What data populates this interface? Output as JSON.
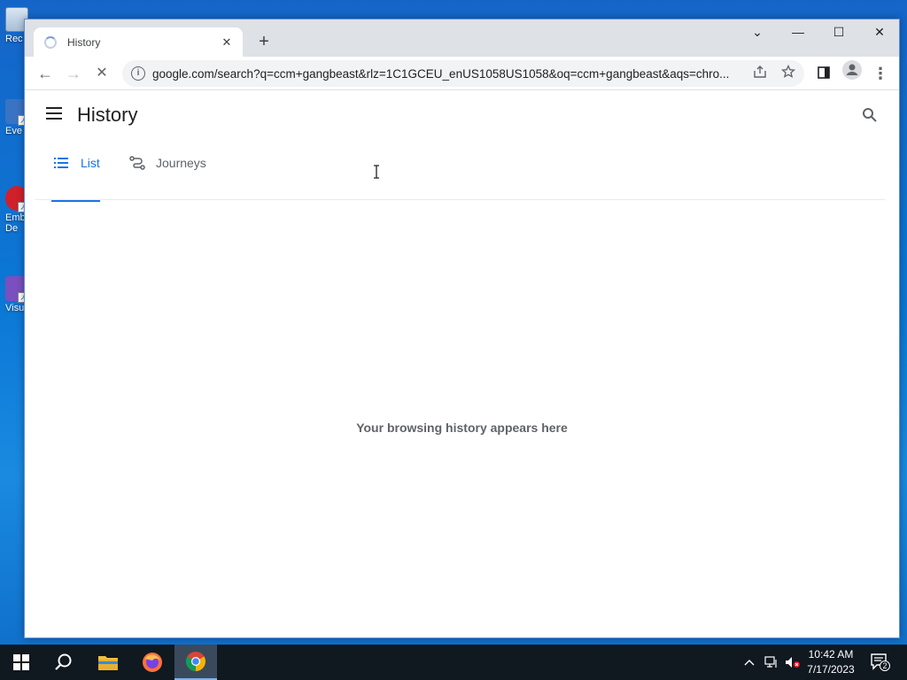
{
  "desktop": {
    "icons": [
      {
        "label": "Rec"
      },
      {
        "label": "Eve"
      },
      {
        "label": "Emb",
        "label2": "De"
      },
      {
        "label": "Visu"
      }
    ]
  },
  "browser": {
    "tab": {
      "title": "History",
      "close": "✕"
    },
    "new_tab": "+",
    "window_controls": {
      "tabsearch": "⌄",
      "minimize": "—",
      "maximize": "☐",
      "close": "✕"
    },
    "toolbar": {
      "back": "←",
      "forward": "→",
      "stop": "✕",
      "url": "google.com/search?q=ccm+gangbeast&rlz=1C1GCEU_enUS1058US1058&oq=ccm+gangbeast&aqs=chro..."
    }
  },
  "history": {
    "title": "History",
    "tabs": [
      {
        "label": "List",
        "active": true
      },
      {
        "label": "Journeys",
        "active": false
      }
    ],
    "empty_message": "Your browsing history appears here"
  },
  "taskbar": {
    "time": "10:42 AM",
    "date": "7/17/2023",
    "notification_count": "2"
  },
  "colors": {
    "accent": "#1a73e8",
    "desktop": "#0b78d6",
    "taskbar": "#101820"
  }
}
